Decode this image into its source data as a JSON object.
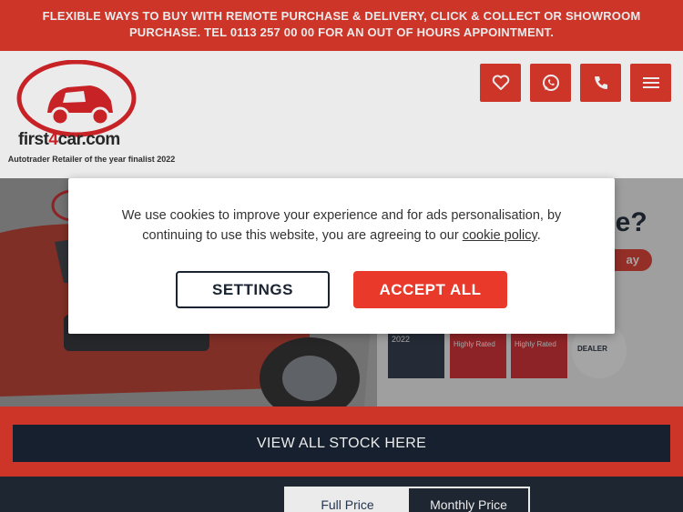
{
  "banner": {
    "text": "FLEXIBLE WAYS TO BUY WITH REMOTE PURCHASE & DELIVERY, CLICK & COLLECT OR SHOWROOM PURCHASE. TEL 0113 257 00 00 FOR AN OUT OF HOURS APPOINTMENT."
  },
  "header": {
    "logo_text_prefix": "first",
    "logo_text_four": "4",
    "logo_text_suffix": "car.com",
    "award_text": "Autotrader Retailer of the year finalist 2022",
    "buttons": [
      {
        "icon": "heart-icon"
      },
      {
        "icon": "whatsapp-icon"
      },
      {
        "icon": "phone-icon"
      },
      {
        "icon": "menu-icon"
      }
    ]
  },
  "hero": {
    "headline_fragment": "ce?",
    "cta_fragment": "ay",
    "badges": [
      "2022",
      "Highly Rated",
      "Highly Rated",
      "DEALER"
    ]
  },
  "cookie_banner": {
    "message": "We use cookies to improve your experience and for ads personalisation, by continuing to use this website, you are agreeing to our",
    "link_text": "cookie policy",
    "trailing": ".",
    "settings_label": "SETTINGS",
    "accept_label": "ACCEPT ALL"
  },
  "stock": {
    "button_label": "VIEW ALL STOCK HERE"
  },
  "price_toggle": {
    "full_label": "Full Price",
    "monthly_label": "Monthly Price"
  },
  "colors": {
    "brand_red": "#e03a2d",
    "navy": "#1a2332",
    "footer": "#212a37"
  }
}
